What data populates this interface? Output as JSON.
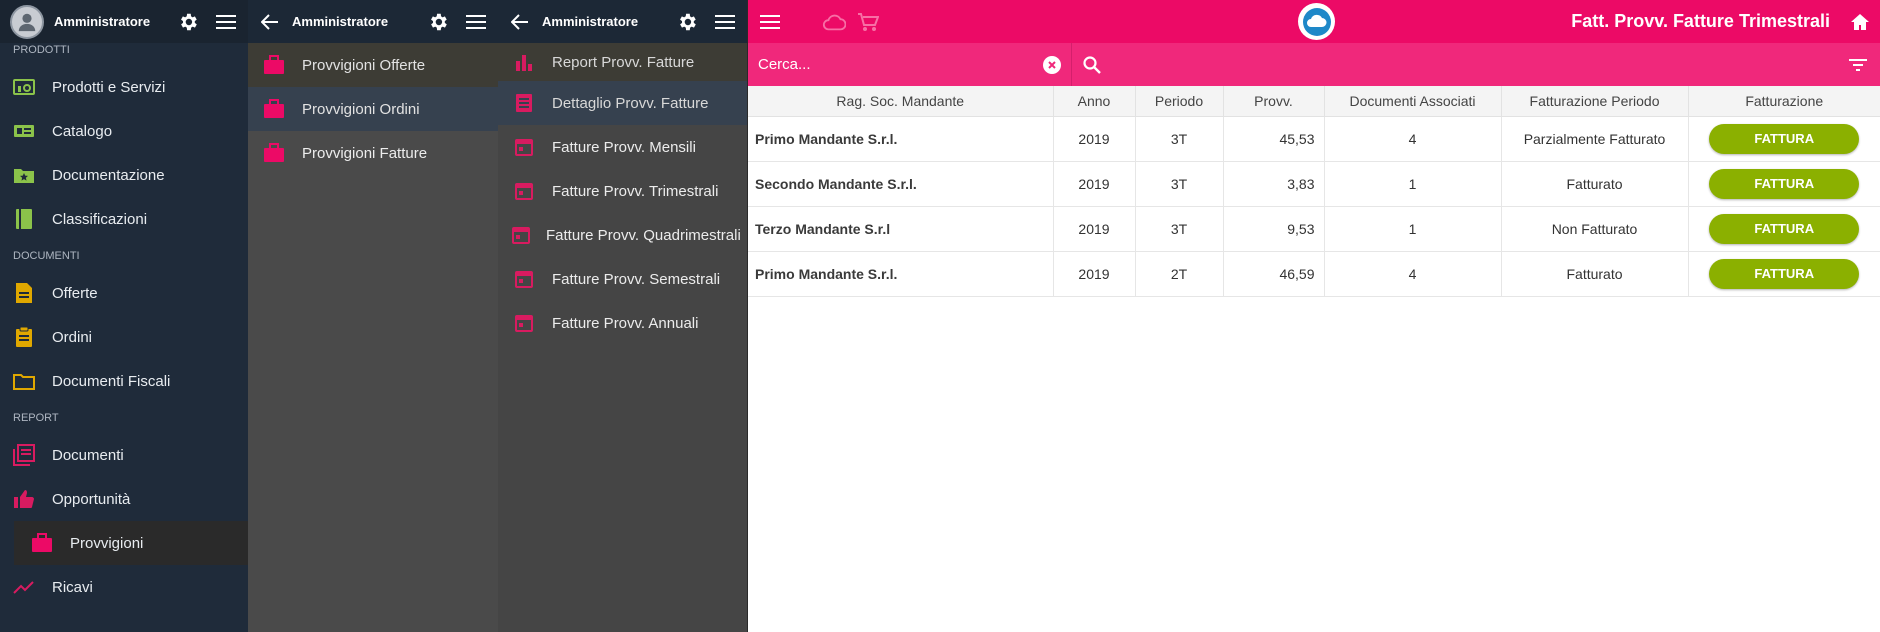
{
  "panel1": {
    "user": "Amministratore",
    "sections": [
      {
        "label": "PRODOTTI",
        "items": [
          {
            "label": "Prodotti e Servizi",
            "icon": "product-icon",
            "color": "#8bc34a"
          },
          {
            "label": "Catalogo",
            "icon": "catalog-icon",
            "color": "#8bc34a"
          },
          {
            "label": "Documentazione",
            "icon": "folder-star-icon",
            "color": "#8bc34a"
          },
          {
            "label": "Classificazioni",
            "icon": "book-icon",
            "color": "#8bc34a"
          }
        ]
      },
      {
        "label": "DOCUMENTI",
        "items": [
          {
            "label": "Offerte",
            "icon": "document-icon",
            "color": "#e0a800"
          },
          {
            "label": "Ordini",
            "icon": "clipboard-icon",
            "color": "#e0a800"
          },
          {
            "label": "Documenti Fiscali",
            "icon": "folder-icon",
            "color": "#e0a800"
          }
        ]
      },
      {
        "label": "REPORT",
        "items": [
          {
            "label": "Documenti",
            "icon": "report-list-icon",
            "color": "#d81b60"
          },
          {
            "label": "Opportunità",
            "icon": "thumb-up-icon",
            "color": "#d81b60"
          },
          {
            "label": "Provvigioni",
            "icon": "briefcase-icon",
            "color": "#ec0a66"
          },
          {
            "label": "Ricavi",
            "icon": "trending-up-icon",
            "color": "#d81b60"
          }
        ]
      }
    ]
  },
  "panel2": {
    "title": "Amministratore",
    "items": [
      {
        "label": "Provvigioni Offerte"
      },
      {
        "label": "Provvigioni Ordini"
      },
      {
        "label": "Provvigioni Fatture"
      }
    ]
  },
  "panel3": {
    "title": "Amministratore",
    "items": [
      {
        "label": "Report Provv. Fatture",
        "icon": "bar-chart-icon"
      },
      {
        "label": "Dettaglio Provv. Fatture",
        "icon": "list-icon"
      },
      {
        "label": "Fatture Provv. Mensili",
        "icon": "calendar-icon"
      },
      {
        "label": "Fatture Provv. Trimestrali",
        "icon": "calendar-icon"
      },
      {
        "label": "Fatture Provv. Quadrimestrali",
        "icon": "calendar-icon"
      },
      {
        "label": "Fatture Provv. Semestrali",
        "icon": "calendar-icon"
      },
      {
        "label": "Fatture Provv. Annuali",
        "icon": "calendar-icon"
      }
    ]
  },
  "main": {
    "title": "Fatt. Provv. Fatture Trimestrali",
    "search_placeholder": "Cerca...",
    "accent": "#ec0a66",
    "columns": [
      "Rag. Soc. Mandante",
      "Anno",
      "Periodo",
      "Provv.",
      "Documenti Associati",
      "Fatturazione Periodo",
      "Fatturazione"
    ],
    "rows": [
      {
        "name": "Primo Mandante S.r.l.",
        "anno": "2019",
        "periodo": "3T",
        "provv": "45,53",
        "docs": "4",
        "stato": "Parzialmente Fatturato",
        "action": "FATTURA"
      },
      {
        "name": "Secondo Mandante S.r.l.",
        "anno": "2019",
        "periodo": "3T",
        "provv": "3,83",
        "docs": "1",
        "stato": "Fatturato",
        "action": "FATTURA"
      },
      {
        "name": "Terzo Mandante S.r.l",
        "anno": "2019",
        "periodo": "3T",
        "provv": "9,53",
        "docs": "1",
        "stato": "Non Fatturato",
        "action": "FATTURA"
      },
      {
        "name": "Primo Mandante S.r.l.",
        "anno": "2019",
        "periodo": "2T",
        "provv": "46,59",
        "docs": "4",
        "stato": "Fatturato",
        "action": "FATTURA"
      }
    ]
  }
}
